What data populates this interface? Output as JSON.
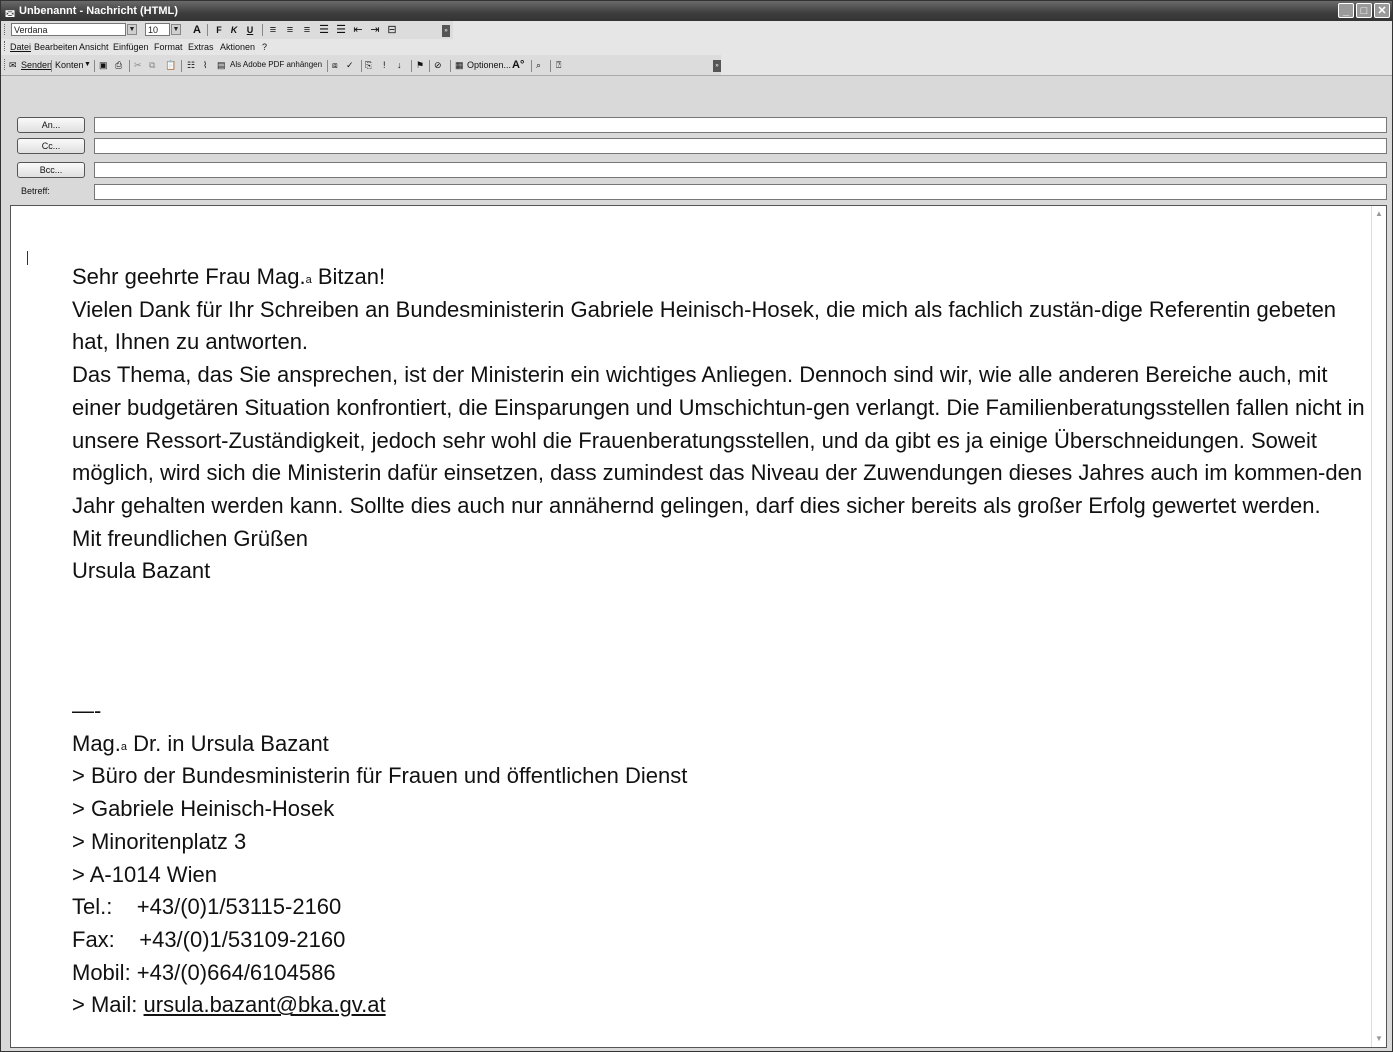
{
  "window": {
    "title": "Unbenannt - Nachricht (HTML)",
    "controls": {
      "minimize": "_",
      "maximize": "□",
      "close": "✕"
    }
  },
  "format_toolbar": {
    "font_name": "Verdana",
    "font_size": "10",
    "buttons": [
      "A",
      "F",
      "K",
      "U"
    ],
    "align_icons": [
      "align-left-icon",
      "align-center-icon",
      "align-right-icon",
      "bullets-icon",
      "numbering-icon",
      "outdent-icon",
      "indent-icon",
      "line-icon"
    ]
  },
  "menu": {
    "items": [
      "Datei",
      "Bearbeiten",
      "Ansicht",
      "Einfügen",
      "Format",
      "Extras",
      "Aktionen",
      "?"
    ]
  },
  "standard_toolbar": {
    "send": "Senden",
    "accounts": "Konten",
    "attach_pdf": "Als Adobe PDF anhängen",
    "options": "Optionen..."
  },
  "header": {
    "to_label": "An...",
    "cc_label": "Cc...",
    "bcc_label": "Bcc...",
    "subject_label": "Betreff:",
    "to_value": "",
    "cc_value": "",
    "bcc_value": "",
    "subject_value": ""
  },
  "body": {
    "greeting_pre": "Sehr geehrte Frau Mag.",
    "greeting_sup": "a",
    "greeting_post": " Bitzan!",
    "paragraph1": "Vielen Dank für Ihr Schreiben an Bundesministerin Gabriele Heinisch-Hosek, die mich als fachlich zustän-dige Referentin gebeten hat, Ihnen zu antworten.",
    "paragraph2": "Das Thema, das Sie ansprechen, ist der Ministerin ein wichtiges Anliegen. Dennoch sind wir, wie alle anderen Bereiche auch, mit einer budgetären Situation konfrontiert, die Einsparungen und Umschichtun-gen verlangt. Die Familienberatungsstellen fallen nicht in unsere Ressort-Zuständigkeit, jedoch sehr wohl die Frauenberatungsstellen, und da gibt es ja einige Überschneidungen. Soweit möglich, wird sich die Ministerin dafür einsetzen, dass zumindest das Niveau der Zuwendungen dieses Jahres auch im kommen-den Jahr gehalten werden kann. Sollte dies auch nur annähernd gelingen, darf dies sicher bereits als großer Erfolg gewertet werden.",
    "closing": "Mit freundlichen Grüßen",
    "name": "Ursula Bazant"
  },
  "signature": {
    "separator": "—-",
    "title_pre": "Mag.",
    "title_sup": "a",
    "title_post": " Dr. in Ursula Bazant",
    "line1": "> Büro der Bundesministerin für Frauen und öffentlichen Dienst",
    "line2": "> Gabriele Heinisch-Hosek",
    "line3": "> Minoritenplatz 3",
    "line4": "> A-1014 Wien",
    "tel": "Tel.:    +43/(0)1/53115-2160",
    "fax": "Fax:    +43/(0)1/53109-2160",
    "mobil": "Mobil: +43/(0)664/6104586",
    "mail_label": "> Mail: ",
    "mail": "ursula.bazant@bka.gv.at"
  }
}
